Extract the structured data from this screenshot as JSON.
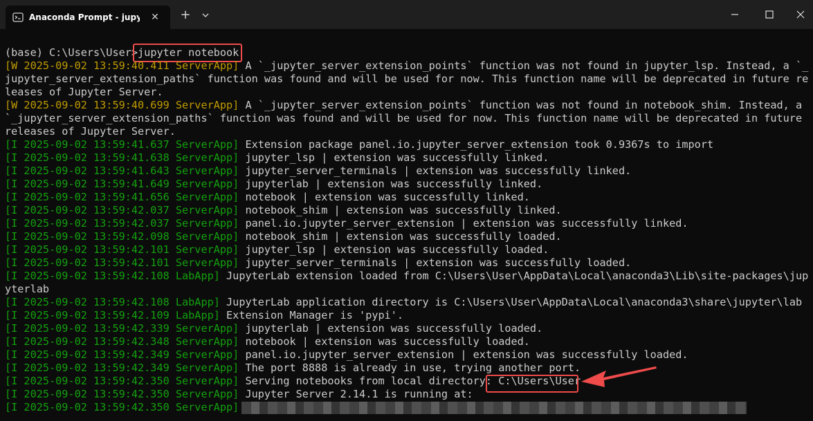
{
  "window": {
    "tab_title": "Anaconda Prompt - jupyter  no",
    "tab_close_glyph": "✕",
    "new_tab_glyph": "+",
    "colors": {
      "titlebar": "#1f1f1f",
      "console_bg": "#0c0c0c",
      "warn": "#c19c00",
      "info": "#13a10e",
      "text": "#cccccc",
      "highlight": "#ef4b4b"
    }
  },
  "prompt": {
    "prefix": "(base) C:\\Users\\User>",
    "command": "jupyter notebook"
  },
  "log": [
    {
      "prefix": "[W 2025-09-02 13:59:40.411 ServerApp]",
      "message": " A `_jupyter_server_extension_points` function was not found in jupyter_lsp. Instead, a `_"
    },
    {
      "prefix": "",
      "message": "jupyter_server_extension_paths` function was found and will be used for now. This function name will be deprecated in future re"
    },
    {
      "prefix": "",
      "message": "leases of Jupyter Server."
    },
    {
      "prefix": "[W 2025-09-02 13:59:40.699 ServerApp]",
      "message": " A `_jupyter_server_extension_points` function was not found in notebook_shim. Instead, a"
    },
    {
      "prefix": "",
      "message": "`_jupyter_server_extension_paths` function was found and will be used for now. This function name will be deprecated in future"
    },
    {
      "prefix": "",
      "message": "releases of Jupyter Server."
    },
    {
      "prefix": "[I 2025-09-02 13:59:41.637 ServerApp]",
      "message": " Extension package panel.io.jupyter_server_extension took 0.9367s to import"
    },
    {
      "prefix": "[I 2025-09-02 13:59:41.638 ServerApp]",
      "message": " jupyter_lsp | extension was successfully linked."
    },
    {
      "prefix": "[I 2025-09-02 13:59:41.643 ServerApp]",
      "message": " jupyter_server_terminals | extension was successfully linked."
    },
    {
      "prefix": "[I 2025-09-02 13:59:41.649 ServerApp]",
      "message": " jupyterlab | extension was successfully linked."
    },
    {
      "prefix": "[I 2025-09-02 13:59:41.656 ServerApp]",
      "message": " notebook | extension was successfully linked."
    },
    {
      "prefix": "[I 2025-09-02 13:59:42.037 ServerApp]",
      "message": " notebook_shim | extension was successfully linked."
    },
    {
      "prefix": "[I 2025-09-02 13:59:42.037 ServerApp]",
      "message": " panel.io.jupyter_server_extension | extension was successfully linked."
    },
    {
      "prefix": "[I 2025-09-02 13:59:42.098 ServerApp]",
      "message": " notebook_shim | extension was successfully loaded."
    },
    {
      "prefix": "[I 2025-09-02 13:59:42.101 ServerApp]",
      "message": " jupyter_lsp | extension was successfully loaded."
    },
    {
      "prefix": "[I 2025-09-02 13:59:42.101 ServerApp]",
      "message": " jupyter_server_terminals | extension was successfully loaded."
    },
    {
      "prefix": "[I 2025-09-02 13:59:42.108 LabApp]",
      "message": " JupyterLab extension loaded from C:\\Users\\User\\AppData\\Local\\anaconda3\\Lib\\site-packages\\jup"
    },
    {
      "prefix": "",
      "message": "yterlab"
    },
    {
      "prefix": "[I 2025-09-02 13:59:42.108 LabApp]",
      "message": " JupyterLab application directory is C:\\Users\\User\\AppData\\Local\\anaconda3\\share\\jupyter\\lab"
    },
    {
      "prefix": "[I 2025-09-02 13:59:42.109 LabApp]",
      "message": " Extension Manager is 'pypi'."
    },
    {
      "prefix": "[I 2025-09-02 13:59:42.339 ServerApp]",
      "message": " jupyterlab | extension was successfully loaded."
    },
    {
      "prefix": "[I 2025-09-02 13:59:42.348 ServerApp]",
      "message": " notebook | extension was successfully loaded."
    },
    {
      "prefix": "[I 2025-09-02 13:59:42.349 ServerApp]",
      "message": " panel.io.jupyter_server_extension | extension was successfully loaded."
    },
    {
      "prefix": "[I 2025-09-02 13:59:42.349 ServerApp]",
      "message": " The port 8888 is already in use, trying another port."
    },
    {
      "prefix": "[I 2025-09-02 13:59:42.350 ServerApp]",
      "message": " Serving notebooks from local directory: C:\\Users\\User"
    },
    {
      "prefix": "[I 2025-09-02 13:59:42.350 ServerApp]",
      "message": " Jupyter Server 2.14.1 is running at:"
    },
    {
      "prefix": "[I 2025-09-02 13:59:42.350 ServerApp]",
      "message": ""
    }
  ]
}
